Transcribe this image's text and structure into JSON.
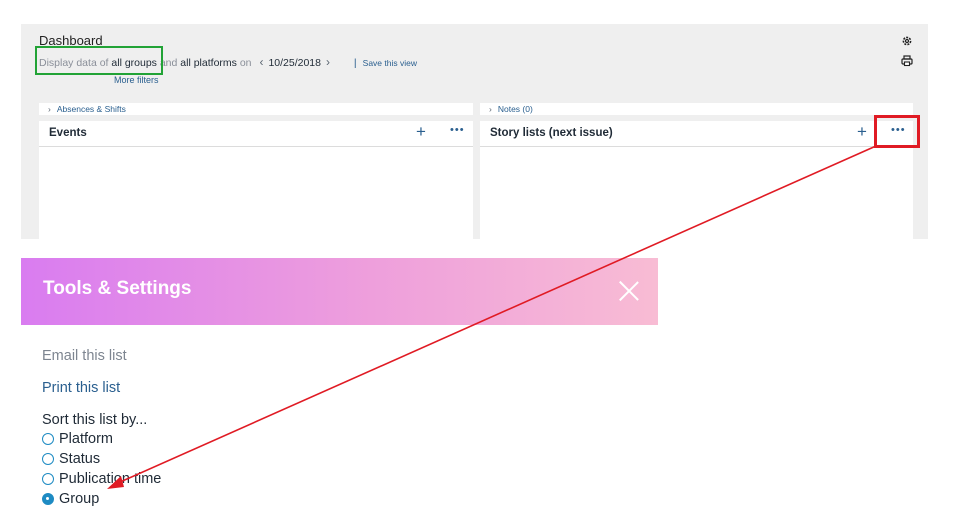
{
  "dashboard": {
    "title": "Dashboard",
    "filter": {
      "prefix": "Display data of",
      "groups": "all groups",
      "and": "and",
      "platforms": "all platforms",
      "on": "on",
      "date": "10/25/2018",
      "separator": "|",
      "save_view": "Save this view",
      "more_filters": "More filters"
    },
    "icons": {
      "settings": "gear-icon",
      "print": "printer-icon"
    },
    "left_column": {
      "collapsed_label": "Absences & Shifts",
      "card_title": "Events"
    },
    "right_column": {
      "collapsed_label": "Notes (0)",
      "card_title": "Story lists (next issue)"
    }
  },
  "tools": {
    "title": "Tools & Settings",
    "email": "Email this list",
    "print": "Print this list",
    "sort_label": "Sort this list by...",
    "sort_options": [
      {
        "label": "Platform",
        "selected": false
      },
      {
        "label": "Status",
        "selected": false
      },
      {
        "label": "Publication time",
        "selected": false
      },
      {
        "label": "Group",
        "selected": true
      }
    ]
  },
  "colors": {
    "highlight_green": "#22a336",
    "highlight_red": "#e01b24",
    "accent": "#2a5f8f",
    "radio": "#1e8bc3"
  }
}
